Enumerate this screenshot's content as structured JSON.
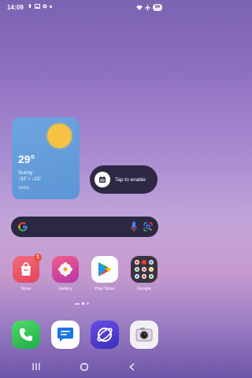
{
  "status_bar": {
    "time": "14:09",
    "battery": "94",
    "icons_left": [
      "notification-icon",
      "photo-icon",
      "settings-icon"
    ],
    "icons_right": [
      "wifi-icon",
      "airplane-icon",
      "battery-icon"
    ]
  },
  "weather": {
    "temperature": "29°",
    "condition": "Sunny",
    "range": "↑32° / ↓13°",
    "city": "Sofia",
    "sun_color": "#f6c241"
  },
  "tap_to_enable": {
    "label": "Tap to enable"
  },
  "search_bar": {
    "icons": [
      "google-icon",
      "mic-icon",
      "lens-icon"
    ]
  },
  "apps": [
    {
      "label": "Store",
      "badge": "1"
    },
    {
      "label": "Gallery"
    },
    {
      "label": "Play Store"
    },
    {
      "label": "Google"
    }
  ],
  "dock": {
    "apps": [
      "phone-icon",
      "messages-icon",
      "internet-icon",
      "camera-icon"
    ]
  },
  "nav_bar": {
    "buttons": [
      "recents-button",
      "home-button",
      "back-button"
    ]
  }
}
